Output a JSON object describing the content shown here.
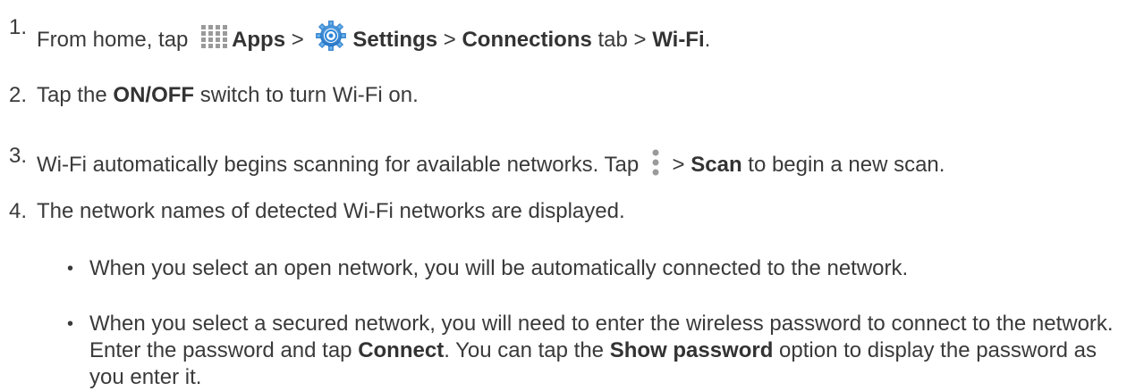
{
  "steps": [
    {
      "number": "1.",
      "t1": "From home, tap ",
      "apps": "Apps",
      "t2": " > ",
      "settings": "Settings",
      "t3": " > ",
      "connections": "Connections",
      "t4": " tab > ",
      "wifi": "Wi-Fi",
      "t5": "."
    },
    {
      "number": "2.",
      "t1": "Tap the ",
      "onoff": "ON/OFF",
      "t2": " switch to turn Wi-Fi on."
    },
    {
      "number": "3.",
      "t1": "Wi-Fi automatically begins scanning for available networks. Tap ",
      "t2": " > ",
      "scan": "Scan",
      "t3": " to begin a new scan."
    },
    {
      "number": "4.",
      "t1": "The network names of detected Wi-Fi networks are displayed."
    }
  ],
  "bullets": [
    {
      "symbol": "•",
      "t1": "When you select an open network, you will be automatically connected to the network."
    },
    {
      "symbol": "•",
      "t1": "When you select a secured network, you will need to enter the wireless password to connect to the network. Enter the password and tap ",
      "connect": "Connect",
      "t2": ". You can tap the ",
      "show_password": "Show password",
      "t3": " option to display the password as you enter it."
    }
  ],
  "icons": {
    "apps": "apps-grid-icon",
    "settings": "settings-gear-icon",
    "menu": "overflow-menu-icon"
  },
  "colors": {
    "text": "#3a3a3a",
    "icon_grey": "#9a9a9a",
    "gear_blue": "#2f86d8"
  }
}
